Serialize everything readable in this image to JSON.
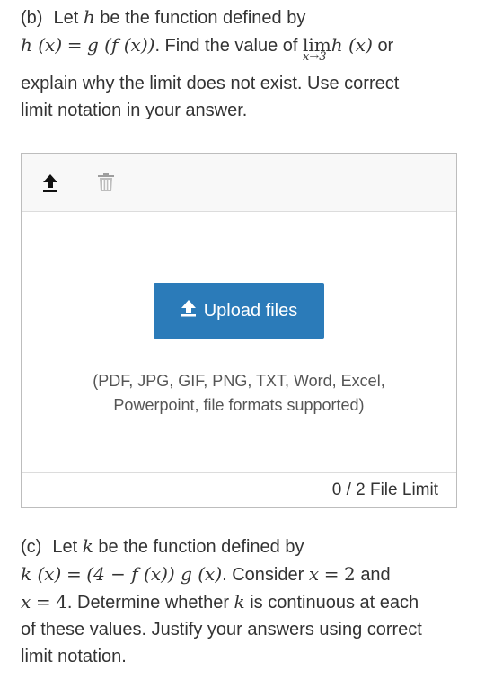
{
  "part_b": {
    "line1_prefix": "(b)",
    "line1_text": "Let",
    "h": "h",
    "line1_rest": "be the function defined by",
    "def_lhs": "h (x)",
    "eq": "=",
    "def_rhs": "g (f (x))",
    "find_text": ". Find the value of",
    "lim": "lim",
    "lim_sub": "x→3",
    "lim_expr": "h (x)",
    "or": "or",
    "line3": "explain why the limit does not exist. Use correct",
    "line4": "limit notation in your answer."
  },
  "uploader": {
    "button_label": "Upload files",
    "formats_line1": "(PDF, JPG, GIF, PNG, TXT, Word, Excel,",
    "formats_line2": "Powerpoint, file formats supported)",
    "file_limit": "0 / 2 File Limit"
  },
  "part_c": {
    "prefix": "(c)",
    "let": "Let",
    "k": "k",
    "rest": "be the function defined by",
    "def_lhs": "k (x)",
    "eq": "=",
    "def_rhs": "(4 − f (x)) g (x)",
    "consider": ". Consider",
    "x": "x",
    "eq2": "=",
    "two": "2",
    "and": "and",
    "x2": "x",
    "eq3": "=",
    "four": "4",
    "determine": ". Determine whether",
    "k2": "k",
    "continuous": "is continuous at each",
    "line4": "of these values. Justify your answers using correct",
    "line5": "limit notation."
  },
  "icons": {
    "upload": "upload-arrow-icon",
    "delete": "trash-icon",
    "button_icon": "upload-arrow-icon"
  },
  "colors": {
    "button": "#2b7bb9",
    "text": "#333333",
    "toolbar": "#f8f8f8"
  }
}
